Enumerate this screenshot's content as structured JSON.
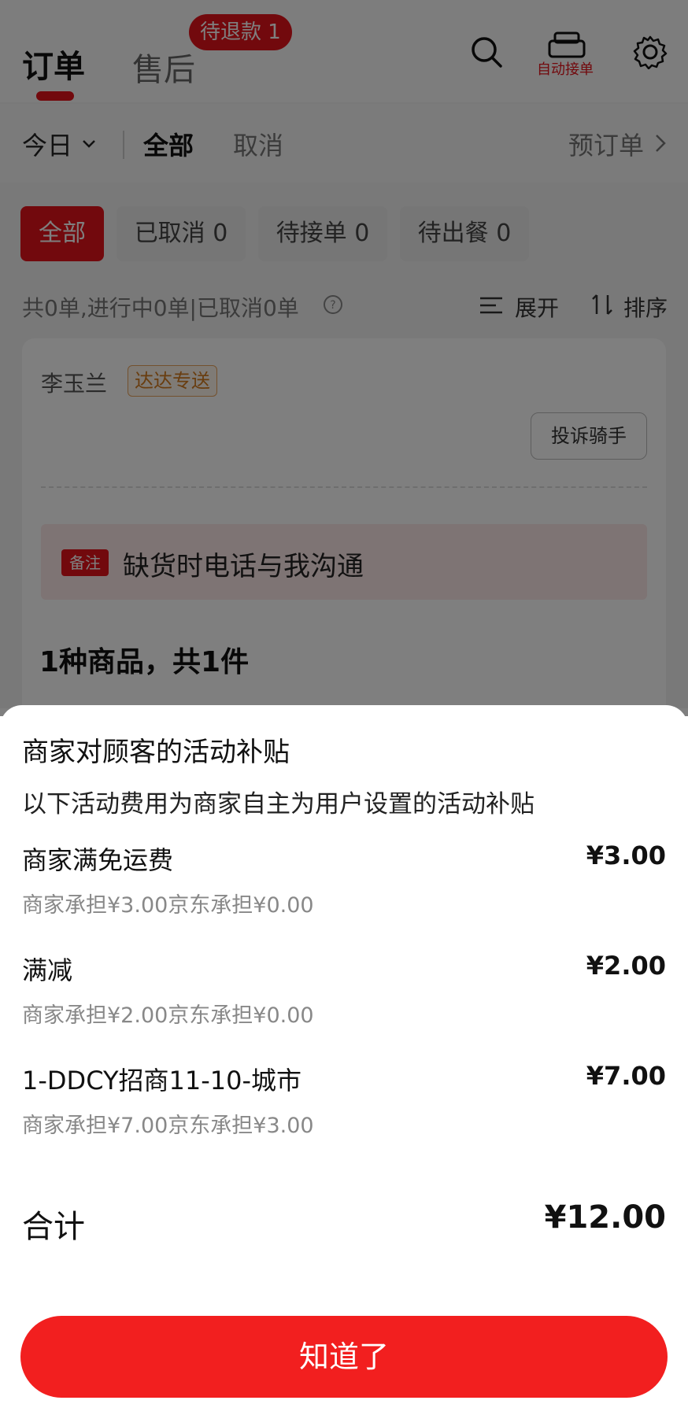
{
  "header": {
    "tab_orders": "订单",
    "tab_after_sales": "售后",
    "refund_badge": "待退款 1",
    "auto_accept_label": "自动接单",
    "accent_color": "#e4131b"
  },
  "filter": {
    "date_label": "今日",
    "tab_all": "全部",
    "tab_cancel": "取消",
    "preorder_label": "预订单"
  },
  "chips": [
    "全部",
    "已取消 0",
    "待接单 0",
    "待出餐 0"
  ],
  "summary": {
    "text": "共0单,进行中0单|已取消0单",
    "expand_label": "展开",
    "sort_label": "排序"
  },
  "order_card": {
    "rider_name": "李玉兰",
    "delivery_tag": "达达专送",
    "complain_button": "投诉骑手",
    "note_badge": "备注",
    "note_text": "缺货时电话与我沟通",
    "item_summary": "1种商品，共1件"
  },
  "sheet": {
    "title": "商家对顾客的活动补贴",
    "subtitle": "以下活动费用为商家自主为用户设置的活动补贴",
    "items": [
      {
        "name": "商家满免运费",
        "amount": "¥3.00",
        "detail": "商家承担¥3.00京东承担¥0.00"
      },
      {
        "name": "满减",
        "amount": "¥2.00",
        "detail": "商家承担¥2.00京东承担¥0.00"
      },
      {
        "name": "1-DDCY招商11-10-城市",
        "amount": "¥7.00",
        "detail": "商家承担¥7.00京东承担¥3.00"
      }
    ],
    "total_label": "合计",
    "total_amount": "¥12.00",
    "confirm_button": "知道了",
    "button_color": "#f21f1f"
  }
}
